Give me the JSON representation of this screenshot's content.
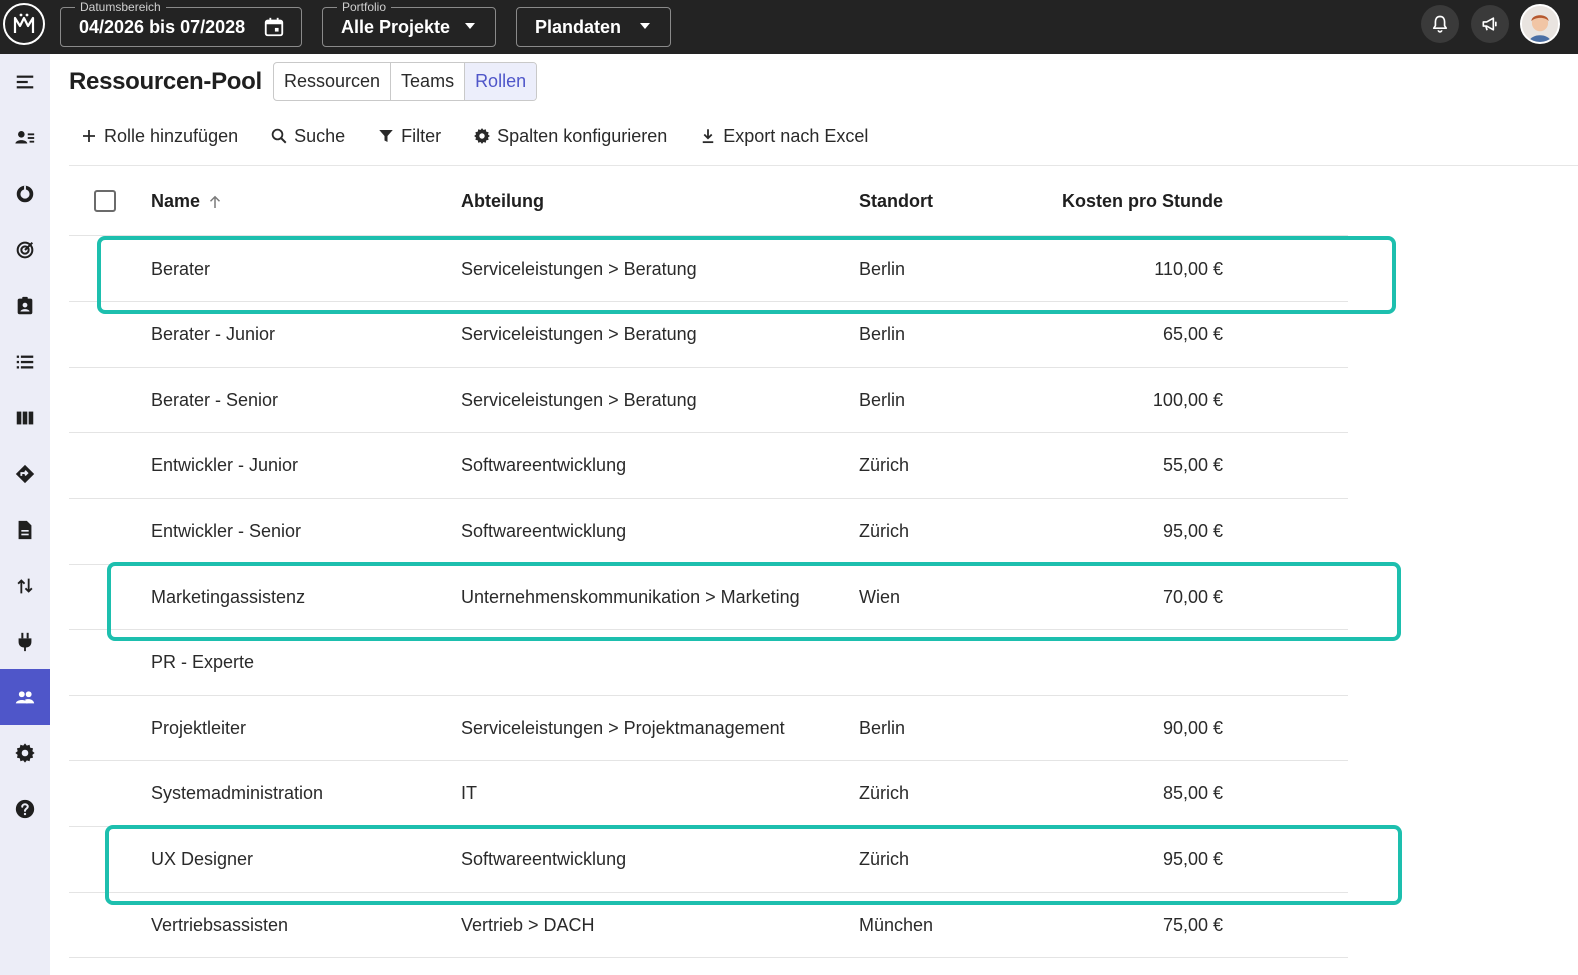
{
  "topbar": {
    "date_range": {
      "legend": "Datumsbereich",
      "value": "04/2026 bis 07/2028"
    },
    "portfolio": {
      "legend": "Portfolio",
      "value": "Alle Projekte"
    },
    "data_mode": {
      "value": "Plandaten"
    }
  },
  "sidebar": {
    "items": [
      {
        "icon": "menu-icon"
      },
      {
        "icon": "person-list-icon"
      },
      {
        "icon": "donut-chart-icon"
      },
      {
        "icon": "target-icon"
      },
      {
        "icon": "contact-card-icon"
      },
      {
        "icon": "list-icon"
      },
      {
        "icon": "columns-icon"
      },
      {
        "icon": "signpost-icon"
      },
      {
        "icon": "document-icon"
      },
      {
        "icon": "swap-vertical-icon"
      },
      {
        "icon": "plug-icon"
      },
      {
        "icon": "people-icon",
        "active": true
      },
      {
        "icon": "gear-icon"
      },
      {
        "icon": "help-icon"
      }
    ]
  },
  "header": {
    "title": "Ressourcen-Pool",
    "tabs": [
      {
        "label": "Ressourcen",
        "active": false
      },
      {
        "label": "Teams",
        "active": false
      },
      {
        "label": "Rollen",
        "active": true
      }
    ]
  },
  "toolbar": {
    "add_role": "Rolle hinzufügen",
    "search": "Suche",
    "filter": "Filter",
    "configure_columns": "Spalten konfigurieren",
    "export_excel": "Export nach Excel"
  },
  "table": {
    "columns": {
      "name": "Name",
      "department": "Abteilung",
      "location": "Standort",
      "cost": "Kosten pro Stunde"
    },
    "rows": [
      {
        "name": "Berater",
        "department": "Serviceleistungen > Beratung",
        "location": "Berlin",
        "cost": "110,00 €",
        "highlighted": true
      },
      {
        "name": "Berater - Junior",
        "department": "Serviceleistungen > Beratung",
        "location": "Berlin",
        "cost": "65,00 €"
      },
      {
        "name": "Berater - Senior",
        "department": "Serviceleistungen > Beratung",
        "location": "Berlin",
        "cost": "100,00 €"
      },
      {
        "name": "Entwickler - Junior",
        "department": "Softwareentwicklung",
        "location": "Zürich",
        "cost": "55,00 €"
      },
      {
        "name": "Entwickler - Senior",
        "department": "Softwareentwicklung",
        "location": "Zürich",
        "cost": "95,00 €"
      },
      {
        "name": "Marketingassistenz",
        "department": "Unternehmenskommunikation > Marketing",
        "location": "Wien",
        "cost": "70,00 €",
        "highlighted": true
      },
      {
        "name": "PR - Experte",
        "department": "",
        "location": "",
        "cost": ""
      },
      {
        "name": "Projektleiter",
        "department": "Serviceleistungen > Projektmanagement",
        "location": "Berlin",
        "cost": "90,00 €"
      },
      {
        "name": "Systemadministration",
        "department": "IT",
        "location": "Zürich",
        "cost": "85,00 €"
      },
      {
        "name": "UX Designer",
        "department": "Softwareentwicklung",
        "location": "Zürich",
        "cost": "95,00 €",
        "highlighted": true
      },
      {
        "name": "Vertriebsassisten",
        "department": "Vertrieb > DACH",
        "location": "München",
        "cost": "75,00 €"
      }
    ]
  },
  "colors": {
    "accent": "#4f56c9",
    "highlight": "#1dbfae",
    "topbar": "#232323",
    "sidebar": "#ecedf7"
  }
}
